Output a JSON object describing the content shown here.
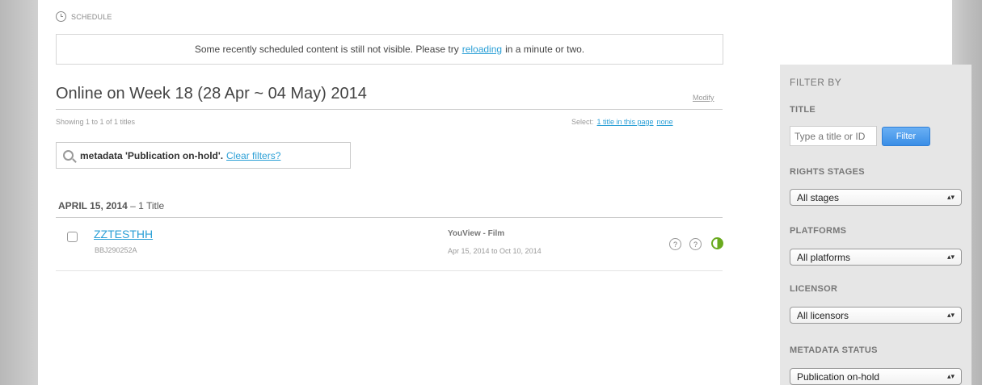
{
  "breadcrumb": {
    "label": "SCHEDULE",
    "icon": "clock-icon"
  },
  "notice": {
    "text_before": "Some recently scheduled content is still not visible. Please try",
    "link": "reloading",
    "text_after": "in a minute or two."
  },
  "page": {
    "title": "Online on Week 18 (28 Apr ~ 04 May) 2014",
    "modify": "Modify",
    "showing": "Showing 1 to 1 of 1 titles",
    "select_label": "Select:",
    "select_page": "1 title in this page",
    "select_none": "none"
  },
  "active_filter": {
    "icon": "magnifier-icon",
    "text": "metadata 'Publication on-hold'.",
    "clear": "Clear filters?"
  },
  "group": {
    "date": "APRIL 15, 2014",
    "count": "– 1 Title"
  },
  "rows": [
    {
      "title": "ZZTESTHH",
      "id": "BBJ290252A",
      "channel": "YouView - Film",
      "dates": "Apr 15, 2014 to Oct 10, 2014",
      "status_icons": [
        "question-icon",
        "question-icon",
        "half-circle-status-icon"
      ],
      "status_color": "#6aaa1f"
    }
  ],
  "sidebar": {
    "filter_by": "FILTER BY",
    "title_label": "TITLE",
    "title_placeholder": "Type a title or ID",
    "filter_button": "Filter",
    "rights_label": "RIGHTS STAGES",
    "rights_value": "All stages",
    "platforms_label": "PLATFORMS",
    "platforms_value": "All platforms",
    "licensor_label": "LICENSOR",
    "licensor_value": "All licensors",
    "metadata_label": "METADATA STATUS",
    "metadata_value": "Publication on-hold"
  },
  "colors": {
    "link": "#2a9fd6",
    "sidebar_bg": "#e6e6e6",
    "button": "#3a8ee6"
  }
}
